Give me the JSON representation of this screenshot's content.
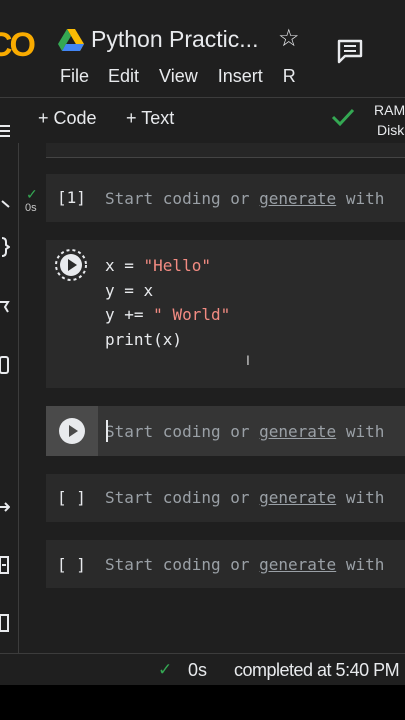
{
  "header": {
    "logo": "CO",
    "title": "Python Practic...",
    "menu": [
      "File",
      "Edit",
      "View",
      "Insert",
      "R"
    ]
  },
  "toolbar": {
    "code_label": "+ Code",
    "text_label": "+ Text",
    "ram_label": "RAM",
    "disk_label": "Disk"
  },
  "cells": [
    {
      "prompt": "[1]",
      "placeholder_before": "Start coding or ",
      "placeholder_link": "generate",
      "placeholder_after": " with",
      "exec_time": "0s"
    },
    {
      "code": {
        "l1_a": "x = ",
        "l1_b": "\"Hello\"",
        "l2": "y = x",
        "l3_a": "y += ",
        "l3_b": "\" World\"",
        "l4": "print(x)"
      }
    },
    {
      "placeholder_before": "Start coding or ",
      "placeholder_link": "generate",
      "placeholder_after": " with"
    },
    {
      "prompt": "[ ]",
      "placeholder_before": "Start coding or ",
      "placeholder_link": "generate",
      "placeholder_after": " with"
    },
    {
      "prompt": "[ ]",
      "placeholder_before": "Start coding or ",
      "placeholder_link": "generate",
      "placeholder_after": " with"
    }
  ],
  "status": {
    "time": "0s",
    "text": "completed at 5:40 PM"
  },
  "colors": {
    "success": "#34a853",
    "string": "#f28b82",
    "logo": "#f9ab00"
  }
}
